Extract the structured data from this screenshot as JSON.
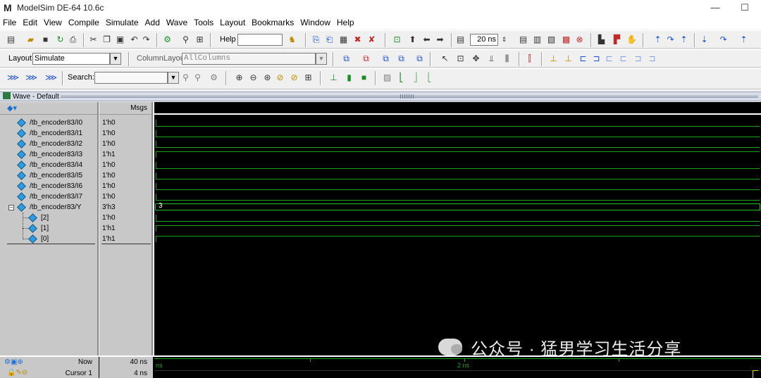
{
  "window": {
    "title": "ModelSim DE-64 10.6c",
    "logo": "M",
    "minimize": "—",
    "maximize": "☐"
  },
  "menu": [
    "File",
    "Edit",
    "View",
    "Compile",
    "Simulate",
    "Add",
    "Wave",
    "Tools",
    "Layout",
    "Bookmarks",
    "Window",
    "Help"
  ],
  "toolbar1": {
    "help_label": "Help",
    "help_value": "",
    "run_length": "20 ns",
    "icons": [
      "new-icon",
      "open-icon",
      "save-icon",
      "reload-icon",
      "print-icon",
      "cut-icon",
      "copy-icon",
      "paste-icon",
      "undo-icon",
      "redo-icon",
      "find-icon",
      "zoom-find-icon",
      "compile-icon",
      "compile-all-icon",
      "simulate-icon",
      "break-icon",
      "step-over-icon",
      "up-arrow-icon",
      "left-arrow-icon",
      "right-arrow-icon",
      "restart-icon",
      "run-icon",
      "continue-icon",
      "run-all-icon",
      "stop-icon",
      "step-icon",
      "step-out-icon",
      "hand-icon"
    ]
  },
  "toolbar2": {
    "layout_label": "Layout",
    "layout_value": "Simulate",
    "column_layout_label": "ColumnLayout",
    "column_layout_value": "AllColumns"
  },
  "toolbar3": {
    "search_label": "Search:",
    "search_value": ""
  },
  "wave": {
    "window_title": "Wave - Default",
    "msgs_header": "Msgs",
    "signals": [
      {
        "name": "/tb_encoder83/I0",
        "value": "1'h0"
      },
      {
        "name": "/tb_encoder83/I1",
        "value": "1'h0"
      },
      {
        "name": "/tb_encoder83/I2",
        "value": "1'h0"
      },
      {
        "name": "/tb_encoder83/I3",
        "value": "1'h1"
      },
      {
        "name": "/tb_encoder83/I4",
        "value": "1'h0"
      },
      {
        "name": "/tb_encoder83/I5",
        "value": "1'h0"
      },
      {
        "name": "/tb_encoder83/I6",
        "value": "1'h0"
      },
      {
        "name": "/tb_encoder83/I7",
        "value": "1'h0"
      },
      {
        "name": "/tb_encoder83/Y",
        "value": "3'h3"
      },
      {
        "name": "[2]",
        "value": "1'h0"
      },
      {
        "name": "[1]",
        "value": "1'h1"
      },
      {
        "name": "[0]",
        "value": "1'h1"
      }
    ],
    "bus_value": "3",
    "signal_levels": [
      0,
      0,
      0,
      1,
      0,
      0,
      0,
      0,
      3,
      0,
      1,
      1
    ],
    "now_label": "Now",
    "now_value": "40 ns",
    "cursor_label": "Cursor 1",
    "cursor_value": "4 ns",
    "timeline_labels": [
      "ns",
      "2 ns"
    ],
    "wave_color": "#19a319"
  },
  "watermark": "公众号 · 猛男学习生活分享"
}
